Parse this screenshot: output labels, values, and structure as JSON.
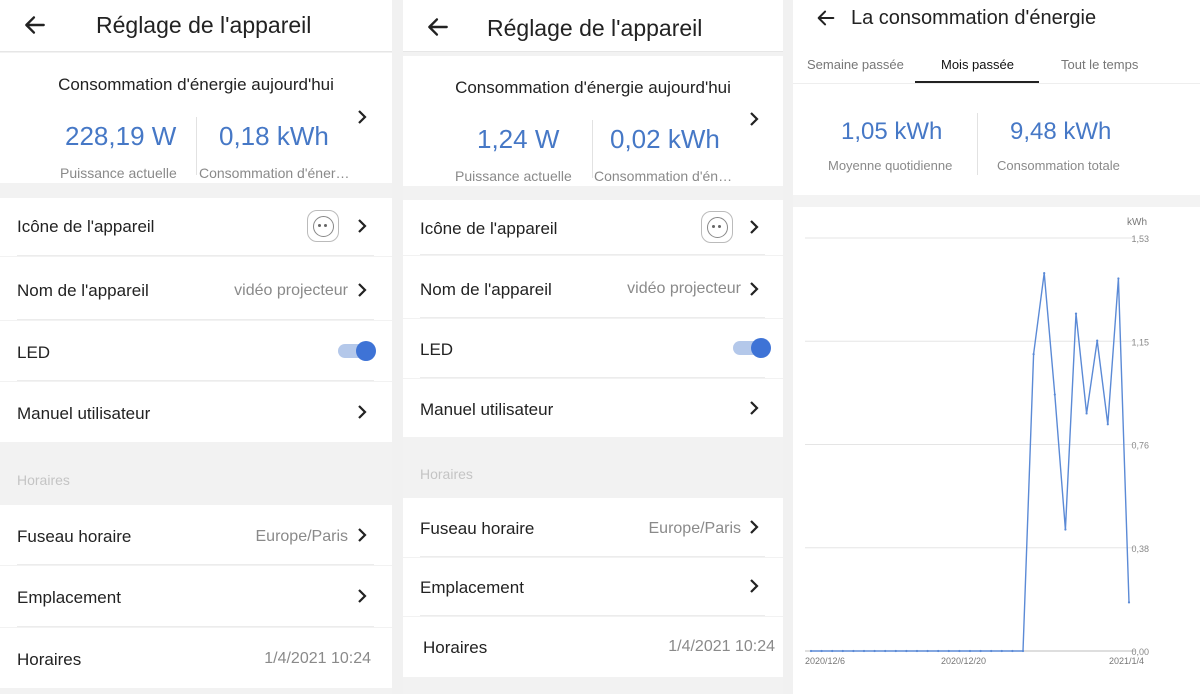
{
  "settings": {
    "title": "Réglage de l'appareil",
    "energy_title": "Consommation d'énergie aujourd'hui",
    "power_label": "Puissance actuelle",
    "consumption_label": "Consommation d'éner…",
    "consumption_label_short": "Consommation d'én…",
    "device_icon_label": "Icône de l'appareil",
    "device_name_label": "Nom de l'appareil",
    "device_name_value": "vidéo projecteur",
    "led_label": "LED",
    "led_on": true,
    "manual_label": "Manuel utilisateur",
    "section_schedules": "Horaires",
    "timezone_label": "Fuseau horaire",
    "timezone_value": "Europe/Paris",
    "location_label": "Emplacement",
    "schedules_label": "Horaires",
    "schedules_value": "1/4/2021 10:24"
  },
  "panel1": {
    "power": "228,19 W",
    "consumption": "0,18 kWh"
  },
  "panel2": {
    "power": "1,24 W",
    "consumption": "0,02 kWh"
  },
  "stats_screen": {
    "title": "La consommation d'énergie",
    "tabs": [
      "Semaine passée",
      "Mois passée",
      "Tout le temps"
    ],
    "active_tab": 1,
    "daily_avg_value": "1,05 kWh",
    "daily_avg_label": "Moyenne quotidienne",
    "total_value": "9,48 kWh",
    "total_label": "Consommation totale"
  },
  "colors": {
    "accent": "#4678c6",
    "line": "#5b8ad6",
    "toggle": "#3e73d6"
  },
  "chart_data": {
    "type": "line",
    "ylabel": "kWh",
    "y_ticks": [
      "0,00",
      "0,38",
      "0,76",
      "1,15",
      "1,53"
    ],
    "ylim": [
      0,
      1.53
    ],
    "x_tick_labels": [
      "2020/12/6",
      "2020/12/20",
      "2021/1/4"
    ],
    "grid": true,
    "series": [
      {
        "values": [
          0,
          0,
          0,
          0,
          0,
          0,
          0,
          0,
          0,
          0,
          0,
          0,
          0,
          0,
          0,
          0,
          0,
          0,
          0,
          0,
          0,
          1.1,
          1.4,
          0.95,
          0.45,
          1.25,
          0.88,
          1.15,
          0.84,
          1.38,
          0.18
        ]
      }
    ]
  }
}
